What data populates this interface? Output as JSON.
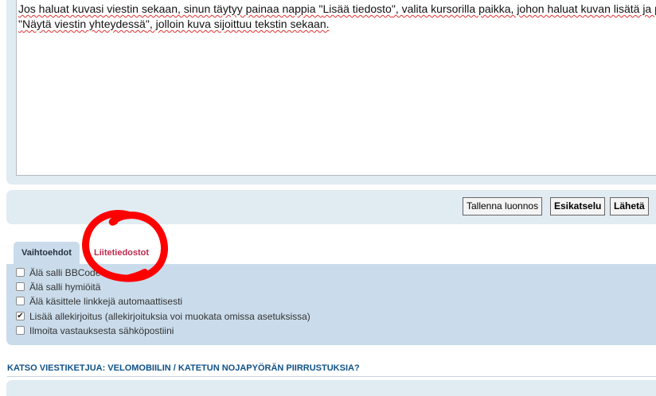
{
  "editor": {
    "line1_parts": [
      "Jos haluat kuvasi viestin sekaan, sinun täytyy painaa nappia \"",
      "Lisää tiedosto",
      "\", valita kursorilla paikka, johon haluat kuvan lisätä ja painaa"
    ],
    "line2_parts": [
      "\"",
      "Näytä viestin yhteydessä",
      "\", jolloin kuva sijoittuu tekstin sekaan."
    ]
  },
  "buttons": {
    "save_draft": "Tallenna luonnos",
    "preview": "Esikatselu",
    "submit": "Lähetä"
  },
  "tabs": {
    "options": "Vaihtoehdot",
    "attachments": "Liitetiedostot"
  },
  "options": [
    {
      "label": "Älä salli BBCode",
      "checked": false
    },
    {
      "label": "Älä salli hymiöitä",
      "checked": false
    },
    {
      "label": "Älä käsittele linkkejä automaattisesti",
      "checked": false
    },
    {
      "label": "Lisää allekirjoitus (allekirjoituksia voi muokata omissa asetuksissa)",
      "checked": true
    },
    {
      "label": "Ilmoita vastauksesta sähköpostiini",
      "checked": false
    }
  ],
  "related_topic": "KATSO VIESTIKETJUA: VELOMOBIILIN / KATETUN NOJAPYÖRÄN PIIRRUSTUKSIA?",
  "colors": {
    "panel": "#e1ebf2",
    "options_panel": "#cadceb",
    "attachments_tab": "#bc2a4d",
    "link": "#105289",
    "annotation": "#ff0000"
  }
}
